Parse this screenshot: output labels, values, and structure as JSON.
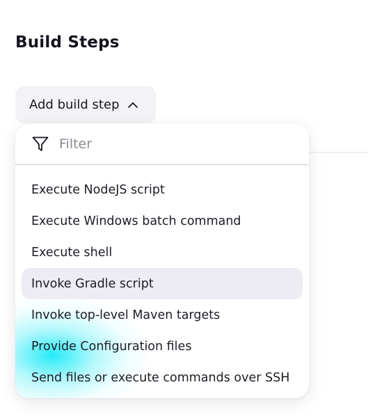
{
  "section": {
    "title": "Build Steps"
  },
  "add_button": {
    "label": "Add build step",
    "icon": "chevron-up-icon"
  },
  "dropdown": {
    "filter": {
      "placeholder": "Filter",
      "value": "",
      "icon": "filter-funnel-icon"
    },
    "items": [
      {
        "label": "Execute NodeJS script"
      },
      {
        "label": "Execute Windows batch command"
      },
      {
        "label": "Execute shell"
      },
      {
        "label": "Invoke Gradle script",
        "highlighted": true
      },
      {
        "label": "Invoke top-level Maven targets"
      },
      {
        "label": "Provide Configuration files"
      },
      {
        "label": "Send files or execute commands over SSH"
      }
    ]
  },
  "colors": {
    "highlight": "#ececf2",
    "button_bg": "#f3f3f6",
    "glow": "#00e8f6"
  }
}
